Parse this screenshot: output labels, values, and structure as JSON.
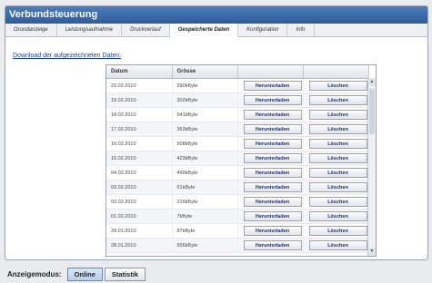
{
  "window": {
    "title": "Verbundsteuerung"
  },
  "tabs": [
    {
      "label": "Grundanzeige"
    },
    {
      "label": "Leistungsaufnahme"
    },
    {
      "label": "Druckverlauf"
    },
    {
      "label": "Gespeicherte Daten"
    },
    {
      "label": "Konfiguration"
    },
    {
      "label": "Info"
    }
  ],
  "active_tab": "Gespeicherte Daten",
  "download_link": "Download der aufgezeichneten Daten:",
  "table": {
    "headers": {
      "date": "Datum",
      "size": "Grösse"
    },
    "download_label": "Herunterladen",
    "delete_label": "Löschen",
    "rows": [
      {
        "date": "22.02.2010",
        "size": "290kByte"
      },
      {
        "date": "19.02.2010",
        "size": "302kByte"
      },
      {
        "date": "18.02.2010",
        "size": "541kByte"
      },
      {
        "date": "17.02.2010",
        "size": "363kByte"
      },
      {
        "date": "16.02.2010",
        "size": "508kByte"
      },
      {
        "date": "15.02.2010",
        "size": "423kByte"
      },
      {
        "date": "04.02.2010",
        "size": "499kByte"
      },
      {
        "date": "03.02.2010",
        "size": "51kByte"
      },
      {
        "date": "02.02.2010",
        "size": "216kByte"
      },
      {
        "date": "01.02.2010",
        "size": "7kByte"
      },
      {
        "date": "29.01.2010",
        "size": "87kByte"
      },
      {
        "date": "28.01.2010",
        "size": "595kByte"
      }
    ]
  },
  "footer": {
    "mode_label": "Anzeigemodus:",
    "buttons": [
      {
        "label": "Online"
      },
      {
        "label": "Statistik"
      }
    ],
    "active": "Online"
  },
  "icons": {
    "scroll_up": "arrow-up-icon",
    "scroll_down": "arrow-down-icon"
  }
}
